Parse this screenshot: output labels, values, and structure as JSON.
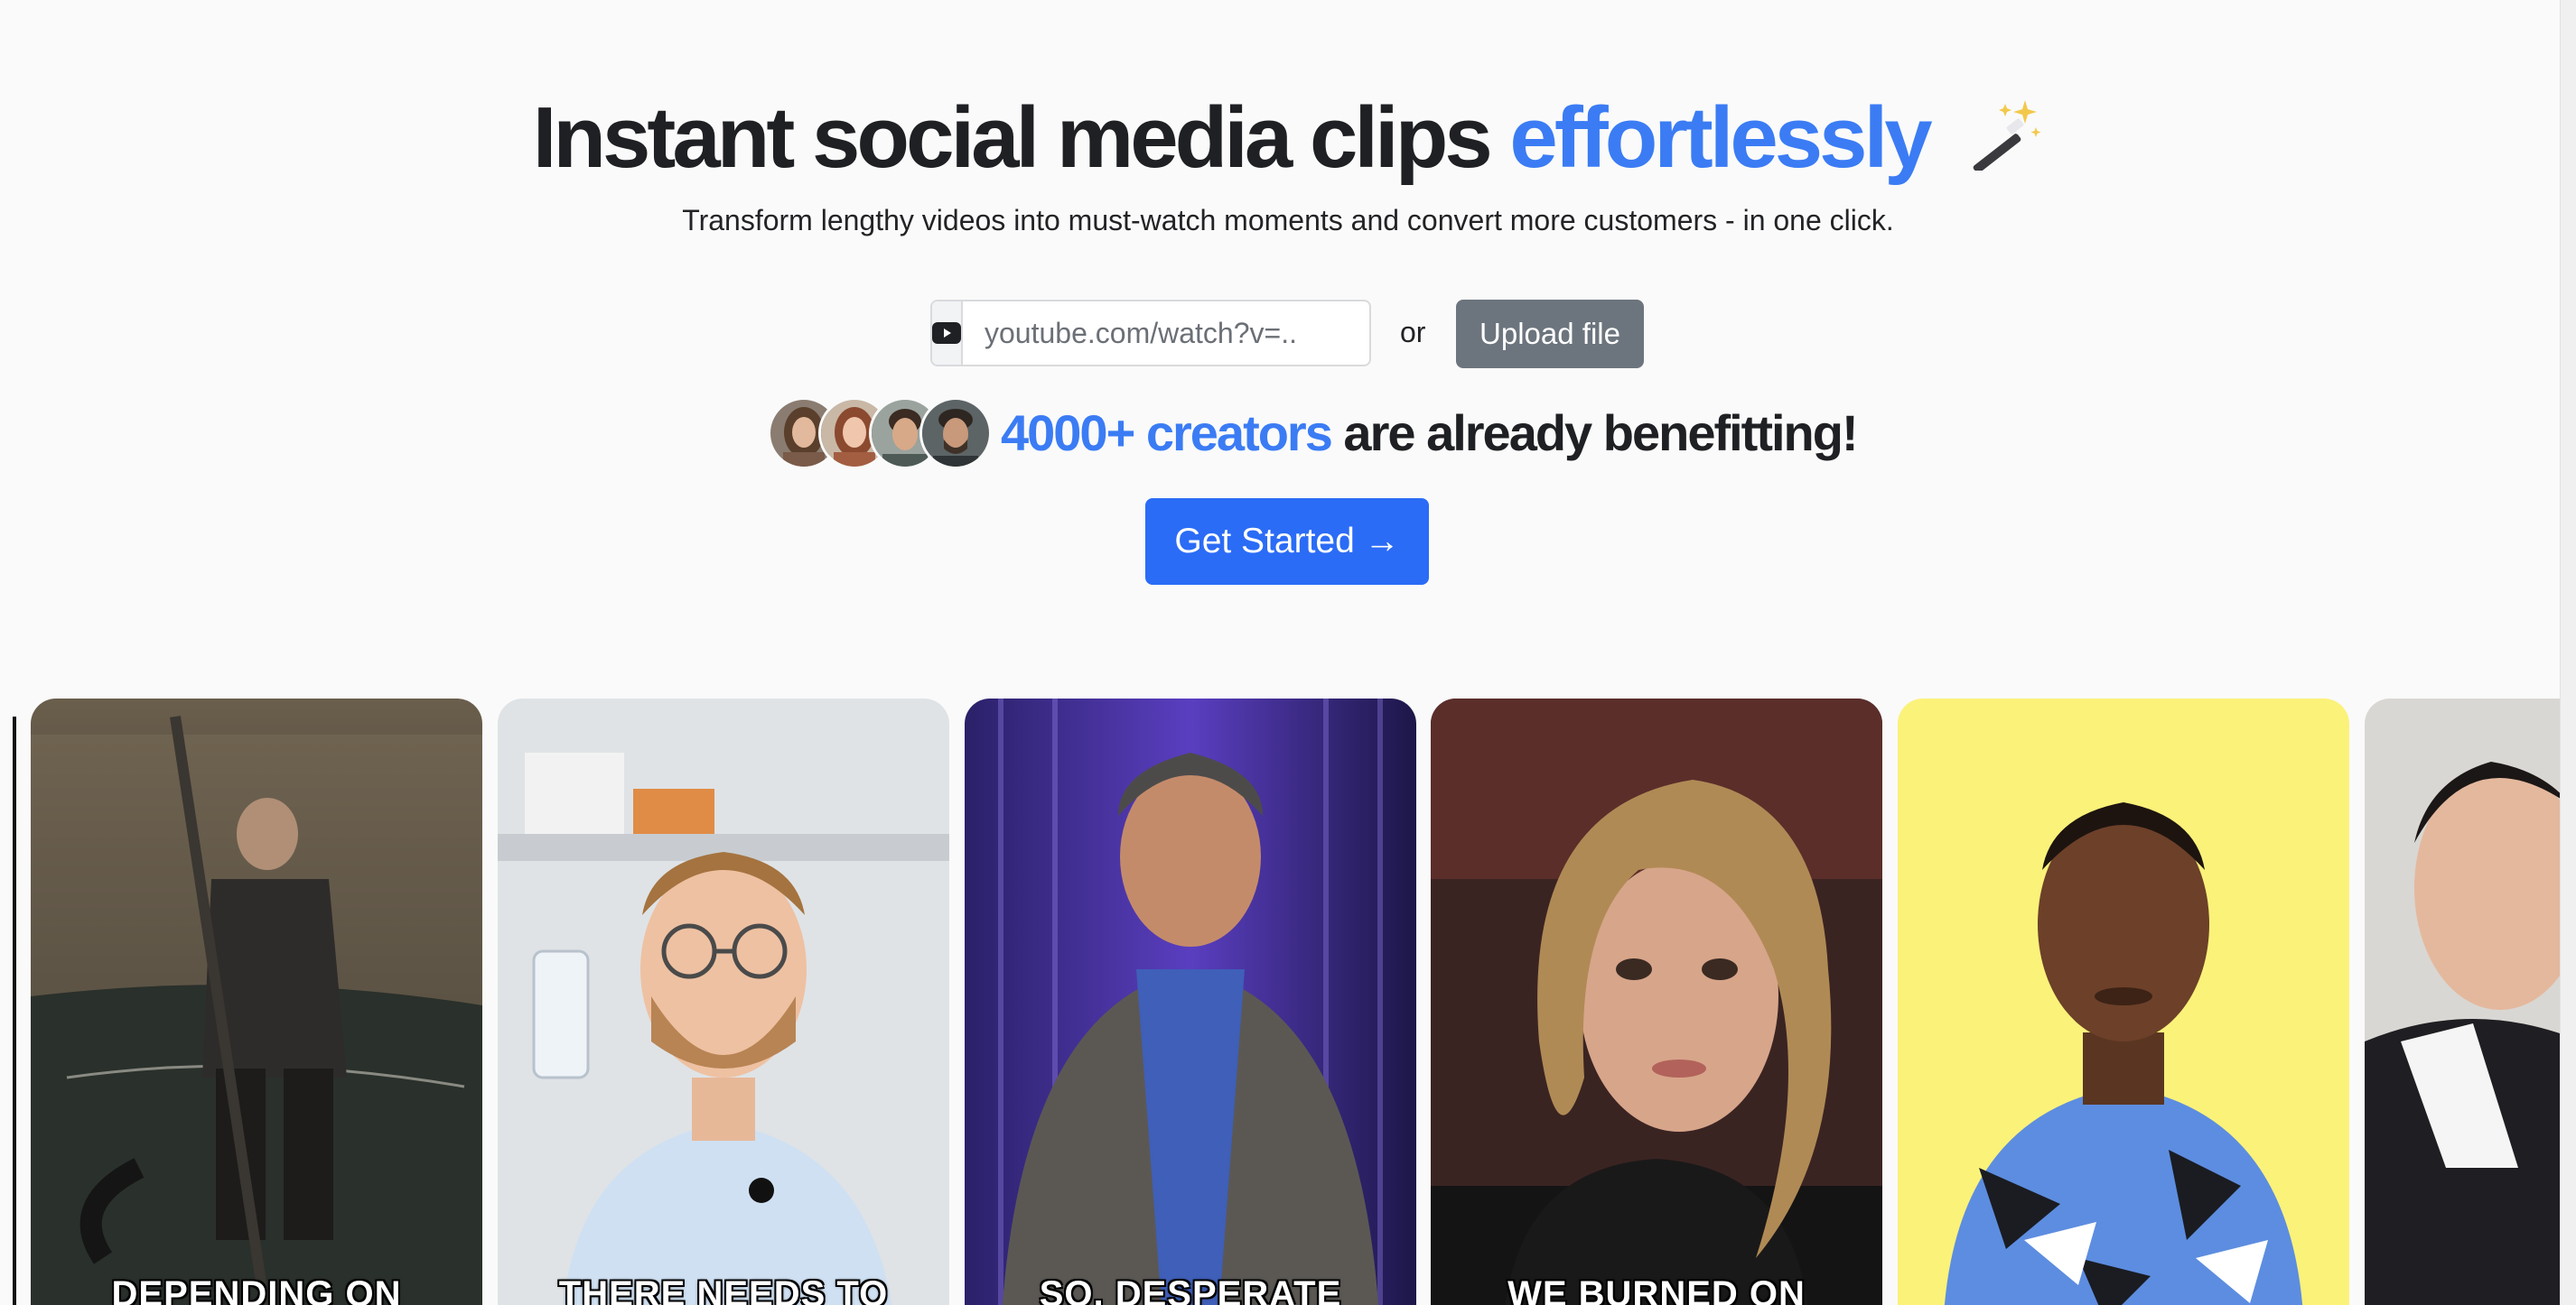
{
  "hero": {
    "headline_main": "Instant social media clips",
    "headline_accent": "effortlessly",
    "subtitle": "Transform lengthy videos into must-watch moments and convert more customers - in one click."
  },
  "url_form": {
    "prefix_icon": "youtube-icon",
    "placeholder": "youtube.com/watch?v=..",
    "or_label": "or",
    "upload_label": "Upload file"
  },
  "social_proof": {
    "count_text": "4000+ creators",
    "rest_text": "are already benefitting!"
  },
  "cta": {
    "label": "Get Started →"
  },
  "clips": [
    {
      "caption": "DEPENDING ON"
    },
    {
      "caption": "THERE NEEDS TO"
    },
    {
      "caption": "SO, DESPERATE"
    },
    {
      "caption": "WE BURNED ON"
    },
    {
      "caption": ""
    },
    {
      "caption": ""
    }
  ],
  "colors": {
    "accent": "#3b7cf4",
    "cta": "#2b6cf6",
    "upload": "#6c757d",
    "background": "#fafafa"
  }
}
